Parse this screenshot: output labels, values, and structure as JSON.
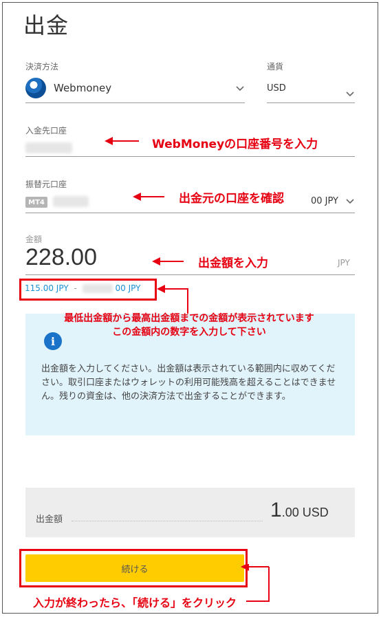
{
  "page": {
    "title": "出金"
  },
  "payment": {
    "method_label": "決済方法",
    "method_value": "Webmoney",
    "method_icon": "webmoney-logo",
    "currency_label": "通貨",
    "currency_value": "USD"
  },
  "dest_account": {
    "label": "入金先口座",
    "annotation": "WebMoneyの口座番号を入力"
  },
  "source_account": {
    "label": "振替元口座",
    "badge": "MT4",
    "balance": "00 JPY",
    "annotation": "出金元の口座を確認"
  },
  "amount": {
    "label": "金額",
    "value": "228.00",
    "currency": "JPY",
    "annotation": "出金額を入力",
    "range_min": "115.00 JPY",
    "range_sep": "-",
    "range_max": "00 JPY"
  },
  "info": {
    "annotation_line1": "最低出金額から最高出金額までの金額が表示されています",
    "annotation_line2": "この金額内の数字を入力して下さい",
    "text": "出金額を入力してください。出金額は表示されている範囲内に収めてください。取引口座またはウォレットの利用可能残高を超えることはできません。残りの資金は、他の決済方法で出金することができます。"
  },
  "summary": {
    "label": "出金額",
    "value_big": "1",
    "value_small": ".00 USD"
  },
  "actions": {
    "continue_label": "続ける",
    "annotation": "入力が終わったら、「続ける」をクリック"
  },
  "colors": {
    "annotation_red": "#e60012",
    "button_yellow": "#ffcc00",
    "info_bg": "#e1f3fb",
    "link_blue": "#1a8fd6"
  }
}
